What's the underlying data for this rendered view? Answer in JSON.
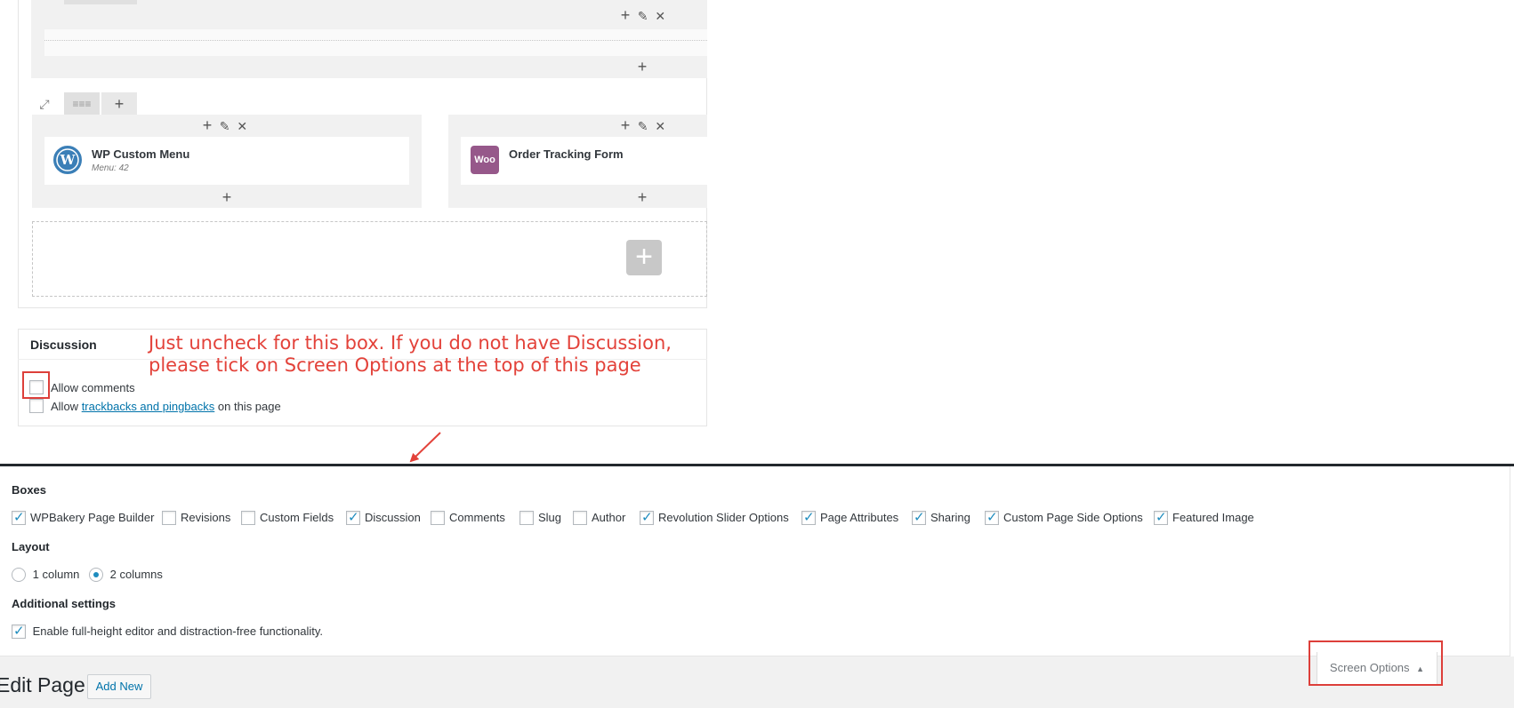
{
  "builder": {
    "row1_icons": {
      "add": "+",
      "edit": "✎",
      "delete": "✕"
    },
    "row2_toolbar": {
      "expand": "⤢",
      "layout": "≡≡≡",
      "add": "+"
    },
    "column_left": {
      "element": {
        "title": "WP Custom Menu",
        "subtitle": "Menu: 42",
        "icon": "wordpress-logo-icon"
      }
    },
    "column_right": {
      "element": {
        "title": "Order Tracking Form",
        "icon": "woo-logo-icon",
        "logo_text": "Woo"
      }
    },
    "add_glyph": "+"
  },
  "discussion": {
    "title": "Discussion",
    "allow_comments": {
      "label": "Allow comments",
      "checked": false
    },
    "allow_trackbacks": {
      "prefix": "Allow ",
      "link": "trackbacks and pingbacks",
      "suffix": " on this page",
      "checked": false
    }
  },
  "annotation": {
    "line1": "Just uncheck for this box. If you do not have Discussion,",
    "line2": "please tick on Screen Options at the top of this page",
    "color": "#e3423a"
  },
  "screen_options": {
    "boxes_title": "Boxes",
    "boxes": [
      {
        "label": "WPBakery Page Builder",
        "checked": true
      },
      {
        "label": "Revisions",
        "checked": false
      },
      {
        "label": "Custom Fields",
        "checked": false
      },
      {
        "label": "Discussion",
        "checked": true
      },
      {
        "label": "Comments",
        "checked": false
      },
      {
        "label": "Slug",
        "checked": false
      },
      {
        "label": "Author",
        "checked": false
      },
      {
        "label": "Revolution Slider Options",
        "checked": true
      },
      {
        "label": "Page Attributes",
        "checked": true
      },
      {
        "label": "Sharing",
        "checked": true
      },
      {
        "label": "Custom Page Side Options",
        "checked": true
      },
      {
        "label": "Featured Image",
        "checked": true
      }
    ],
    "layout_title": "Layout",
    "layout_options": [
      {
        "label": "1 column",
        "checked": false
      },
      {
        "label": "2 columns",
        "checked": true
      }
    ],
    "additional_title": "Additional settings",
    "additional": {
      "label": "Enable full-height editor and distraction-free functionality.",
      "checked": true
    },
    "tab_label": "Screen Options",
    "tab_arrow": "▲"
  },
  "page": {
    "heading": "Edit Page",
    "add_new": "Add New"
  }
}
